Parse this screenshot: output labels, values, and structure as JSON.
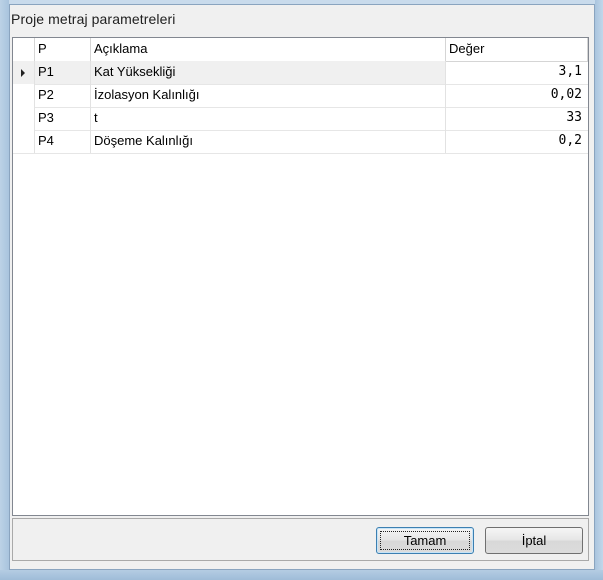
{
  "window": {
    "title": "Proje metraj parametreleri"
  },
  "grid": {
    "columns": [
      "P",
      "Açıklama",
      "Değer"
    ],
    "rows": [
      {
        "p": "P1",
        "desc": "Kat Yüksekliği",
        "value": "3,1",
        "selected": true
      },
      {
        "p": "P2",
        "desc": "İzolasyon Kalınlığı",
        "value": "0,02",
        "selected": false
      },
      {
        "p": "P3",
        "desc": "t",
        "value": "33",
        "selected": false
      },
      {
        "p": "P4",
        "desc": "Döşeme Kalınlığı",
        "value": "0,2",
        "selected": false
      }
    ]
  },
  "buttons": {
    "ok_label": "Tamam",
    "cancel_label": "İptal"
  },
  "icons": {
    "row_indicator": "current-row-triangle-icon"
  }
}
